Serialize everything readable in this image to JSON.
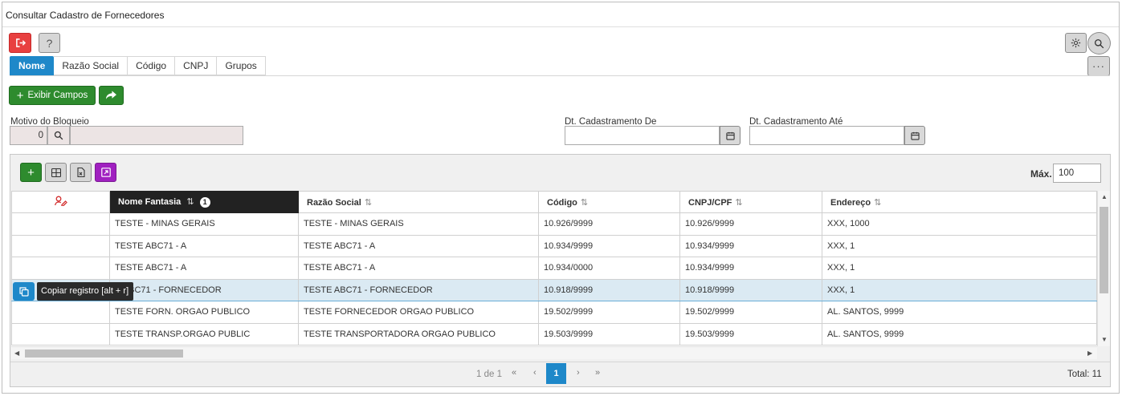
{
  "window": {
    "title": "Consultar Cadastro de Fornecedores"
  },
  "toolbar": {
    "help_label": "?",
    "more_label": "···"
  },
  "tabs": [
    {
      "label": "Nome",
      "active": true
    },
    {
      "label": "Razão Social"
    },
    {
      "label": "Código"
    },
    {
      "label": "CNPJ"
    },
    {
      "label": "Grupos"
    }
  ],
  "actions": {
    "exibir_campos": "Exibir Campos"
  },
  "filters": {
    "motivo_label": "Motivo do Bloqueio",
    "motivo_value": "0",
    "dt_de_label": "Dt. Cadastramento De",
    "dt_ate_label": "Dt. Cadastramento Até"
  },
  "grid": {
    "max_label": "Máx.",
    "max_value": "100",
    "columns": [
      "Nome Fantasia",
      "Razão Social",
      "Código",
      "CNPJ/CPF",
      "Endereço"
    ],
    "sort_order_badge": "1",
    "rows": [
      {
        "nome": "TESTE - MINAS GERAIS",
        "razao": "TESTE - MINAS GERAIS",
        "codigo": "10.926/9999",
        "cnpj": "10.926/9999",
        "endereco": "XXX, 1000"
      },
      {
        "nome": "TESTE ABC71 - A",
        "razao": "TESTE ABC71 - A",
        "codigo": "10.934/9999",
        "cnpj": "10.934/9999",
        "endereco": "XXX, 1"
      },
      {
        "nome": "TESTE ABC71 - A",
        "razao": "TESTE ABC71 - A",
        "codigo": "10.934/0000",
        "cnpj": "10.934/9999",
        "endereco": "XXX, 1"
      },
      {
        "nome": "E ABC71 - FORNECEDOR",
        "razao": "TESTE ABC71 - FORNECEDOR",
        "codigo": "10.918/9999",
        "cnpj": "10.918/9999",
        "endereco": "XXX, 1"
      },
      {
        "nome": "TESTE FORN. ORGAO PUBLICO",
        "razao": "TESTE FORNECEDOR ORGAO PUBLICO",
        "codigo": "19.502/9999",
        "cnpj": "19.502/9999",
        "endereco": "AL. SANTOS, 9999"
      },
      {
        "nome": "TESTE TRANSP.ORGAO PUBLIC",
        "razao": "TESTE TRANSPORTADORA ORGAO PUBLICO",
        "codigo": "19.503/9999",
        "cnpj": "19.503/9999",
        "endereco": "AL. SANTOS, 9999"
      }
    ],
    "selected_row": 3,
    "tooltip": "Copiar registro [alt + r]"
  },
  "pager": {
    "info": "1 de 1",
    "first": "«",
    "prev": "‹",
    "current": "1",
    "next": "›",
    "last": "»",
    "total": "Total: 11"
  },
  "colors": {
    "accent": "#1e88c9",
    "green": "#2e8b2e",
    "danger": "#e84040",
    "purple": "#a020c0"
  }
}
